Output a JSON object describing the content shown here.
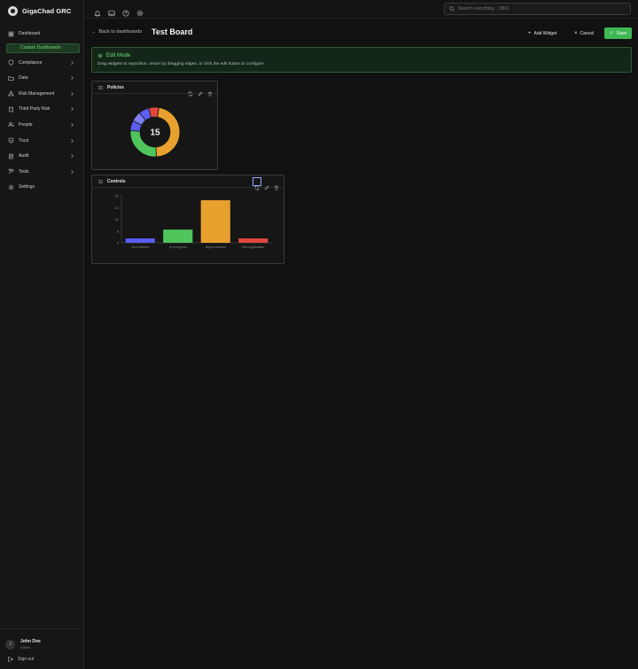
{
  "app": {
    "name": "GigaChad GRC"
  },
  "sidebar": {
    "items": [
      {
        "label": "Dashboard",
        "icon": "home-icon",
        "chevron": false
      },
      {
        "label": "Custom Dashboards",
        "sub": true
      },
      {
        "label": "Compliance",
        "icon": "shield-icon",
        "chevron": true
      },
      {
        "label": "Data",
        "icon": "folder-icon",
        "chevron": true
      },
      {
        "label": "Risk Management",
        "icon": "alert-icon",
        "chevron": true
      },
      {
        "label": "Third Party Risk",
        "icon": "building-icon",
        "chevron": true
      },
      {
        "label": "People",
        "icon": "users-icon",
        "chevron": true
      },
      {
        "label": "Trust",
        "icon": "trust-icon",
        "chevron": true
      },
      {
        "label": "Audit",
        "icon": "audit-icon",
        "chevron": true
      },
      {
        "label": "Tools",
        "icon": "tools-icon",
        "chevron": true
      },
      {
        "label": "Settings",
        "icon": "gear-icon",
        "chevron": false
      }
    ],
    "user": {
      "initial": "J",
      "name": "John Doe",
      "role": "Admin"
    },
    "signout": "Sign out"
  },
  "topbar": {
    "search_placeholder": "Search everything... (⌘K)"
  },
  "header": {
    "back_label": "Back to dashboards",
    "title": "Test Board",
    "add_widget": "Add Widget",
    "cancel": "Cancel",
    "save": "Save"
  },
  "banner": {
    "title": "Edit Mode",
    "text": "Drag widgets to reposition, resize by dragging edges, or click the edit button to configure."
  },
  "widgets": {
    "policies": {
      "title": "Policies",
      "center_value": "15"
    },
    "controls": {
      "title": "Controls"
    }
  },
  "colors": {
    "accent": "#3fb852",
    "orange": "#e8a02e",
    "green": "#4fc55c",
    "blue": "#5b5ef0",
    "red": "#e0463e"
  },
  "chart_data": [
    {
      "type": "pie",
      "donut": true,
      "center_label": "15",
      "slices": [
        {
          "value": 7,
          "color": "#e8a02e"
        },
        {
          "value": 4,
          "color": "#4fc55c"
        },
        {
          "value": 1,
          "color": "#5b5ef0"
        },
        {
          "value": 1,
          "color": "#7c7ff5"
        },
        {
          "value": 1,
          "color": "#5b5ef0"
        },
        {
          "value": 1,
          "color": "#e0463e"
        }
      ]
    },
    {
      "type": "bar",
      "categories": [
        "Not started",
        "In progress",
        "Implemented",
        "Not applicable"
      ],
      "values": [
        3,
        9,
        29,
        3
      ],
      "colors": [
        "#5b5ef0",
        "#4fc55c",
        "#e8a02e",
        "#e0463e"
      ],
      "yticks": [
        0,
        8,
        16,
        24,
        32
      ],
      "ylim": [
        0,
        32
      ],
      "grid": false
    }
  ]
}
